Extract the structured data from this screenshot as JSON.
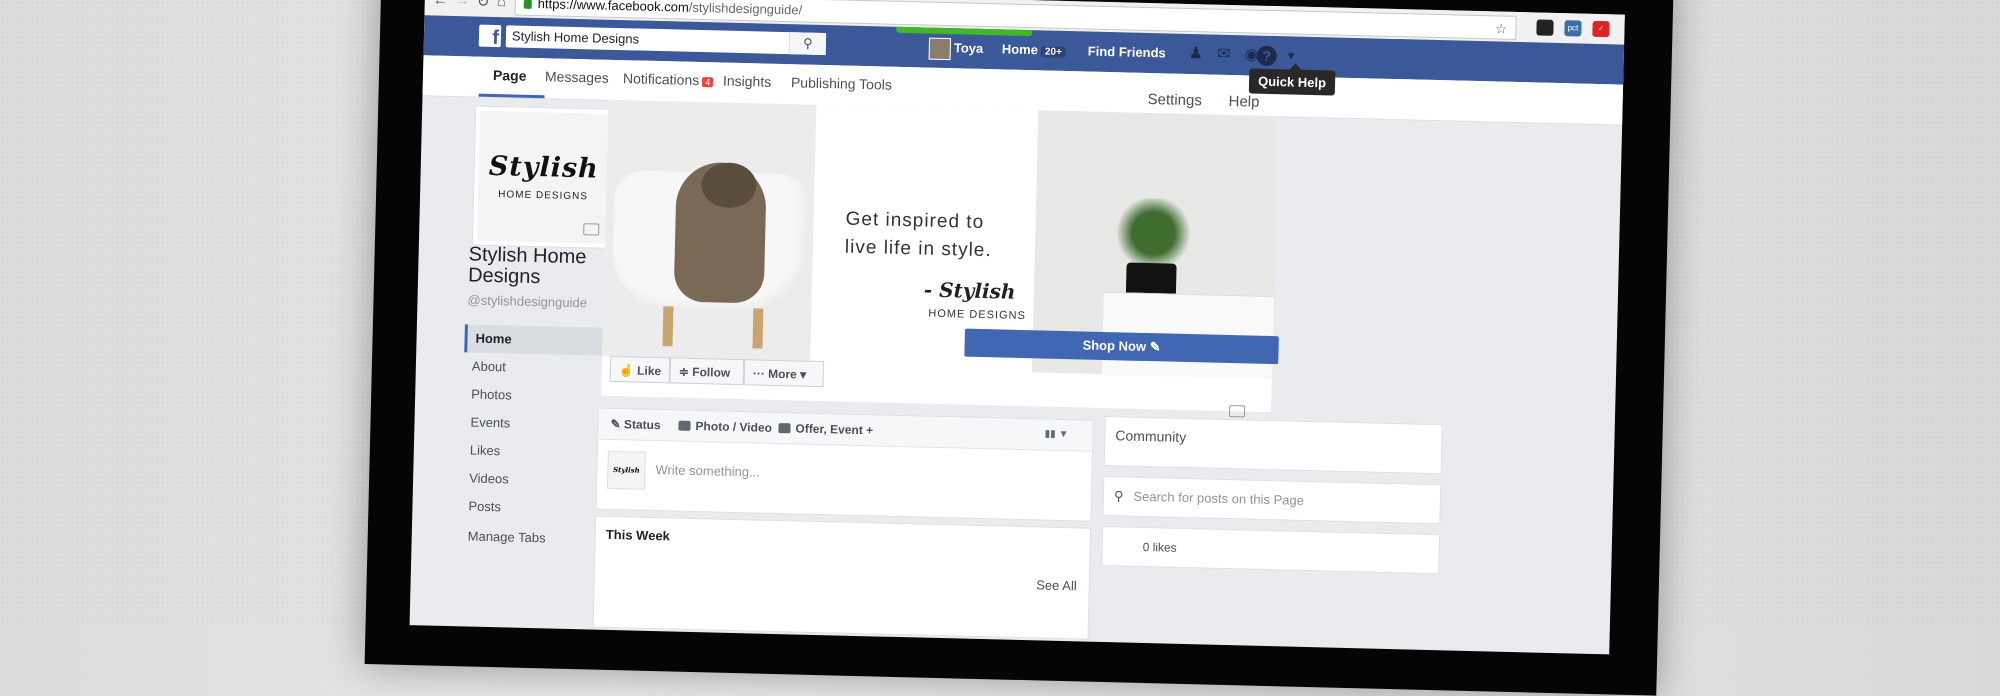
{
  "browser": {
    "url_host": "https://www.facebook.com",
    "url_path": "/stylishdesignguide/"
  },
  "fb_header": {
    "search_value": "Stylish Home Designs",
    "user_name": "Toya",
    "home_label": "Home",
    "home_badge": "20+",
    "find_friends_label": "Find Friends",
    "tooltip": "Quick Help"
  },
  "page_tabs": {
    "items": [
      "Page",
      "Messages",
      "Notifications",
      "Insights",
      "Publishing Tools"
    ],
    "notifications_badge": "4",
    "settings_label": "Settings",
    "help_label": "Help"
  },
  "profile": {
    "logo_script": "Stylish",
    "logo_sub": "HOME DESIGNS",
    "page_name": "Stylish Home Designs",
    "handle": "@stylishdesignguide"
  },
  "left_nav": {
    "items": [
      "Home",
      "About",
      "Photos",
      "Events",
      "Likes",
      "Videos",
      "Posts",
      "Manage Tabs"
    ]
  },
  "cover": {
    "tagline_1": "Get inspired to",
    "tagline_2": "live life in style.",
    "brand": "- Stylish",
    "brand_sub": "HOME DESIGNS"
  },
  "actions": {
    "like": "Like",
    "follow": "Follow",
    "more": "More",
    "shop_now": "Shop Now"
  },
  "composer": {
    "tab_status": "Status",
    "tab_photo": "Photo / Video",
    "tab_offer": "Offer, Event +",
    "placeholder": "Write something...",
    "avatar_text": "Stylish"
  },
  "this_week": {
    "title": "This Week",
    "see_all": "See All"
  },
  "sidebar": {
    "community": "Community",
    "search_placeholder": "Search for posts on this Page",
    "likes_text": "0 likes"
  },
  "colors": {
    "fb_blue": "#3b5998",
    "button_blue": "#4267b2",
    "badge_red": "#fa3e3e"
  }
}
